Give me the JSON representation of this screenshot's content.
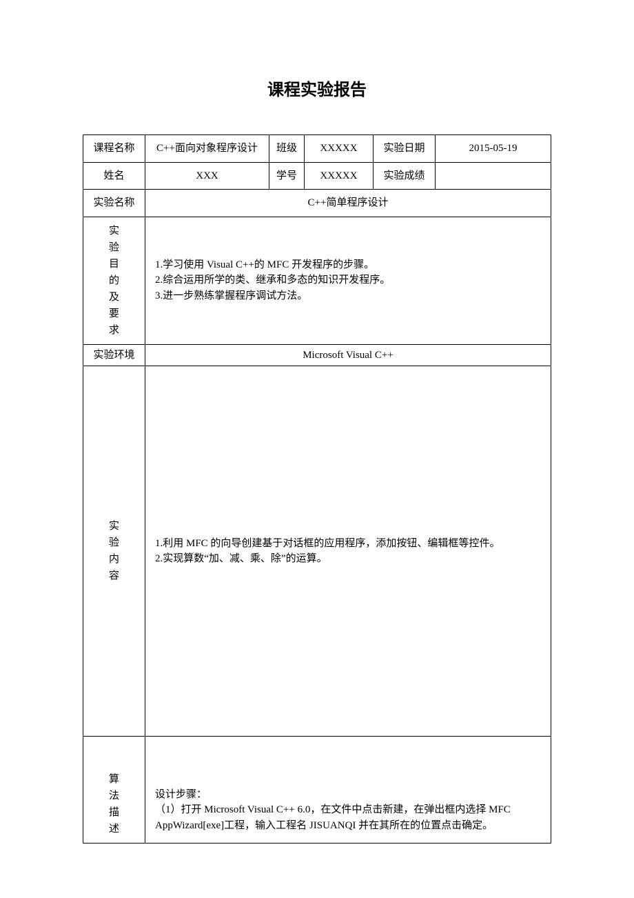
{
  "title": "课程实验报告",
  "row1": {
    "course_label": "课程名称",
    "course_value": "C++面向对象程序设计",
    "class_label": "班级",
    "class_value": "XXXXX",
    "date_label": "实验日期",
    "date_value": "2015-05-19"
  },
  "row2": {
    "name_label": "姓名",
    "name_value": "XXX",
    "id_label": "学号",
    "id_value": "XXXXX",
    "score_label": "实验成绩",
    "score_value": ""
  },
  "row3": {
    "exp_name_label": "实验名称",
    "exp_name_value": "C++简单程序设计"
  },
  "purpose": {
    "c1": "实",
    "c2": "验",
    "c3": "目",
    "c4": "的",
    "c5": "及",
    "c6": "要",
    "c7": "求",
    "line1": "1.学习使用 Visual C++的 MFC 开发程序的步骤。",
    "line2": "2.综合运用所学的类、继承和多态的知识开发程序。",
    "line3": "3.进一步熟练掌握程序调试方法。"
  },
  "env": {
    "label": "实验环境",
    "value": "Microsoft Visual C++"
  },
  "content": {
    "c1": "实",
    "c2": "验",
    "c3": "内",
    "c4": "容",
    "line1": "1.利用 MFC 的向导创建基于对话框的应用程序，添加按钮、编辑框等控件。",
    "line2": "2.实现算数“加、减、乘、除”的运算。"
  },
  "algorithm": {
    "c1": "算",
    "c2": "法",
    "c3": "描",
    "c4": "述",
    "line1": "设计步骤：",
    "line2": "（1）打开 Microsoft Visual C++ 6.0，在文件中点击新建，在弹出框内选择 MFC AppWizard[exe]工程，输入工程名 JISUANQI 并在其所在的位置点击确定。"
  }
}
